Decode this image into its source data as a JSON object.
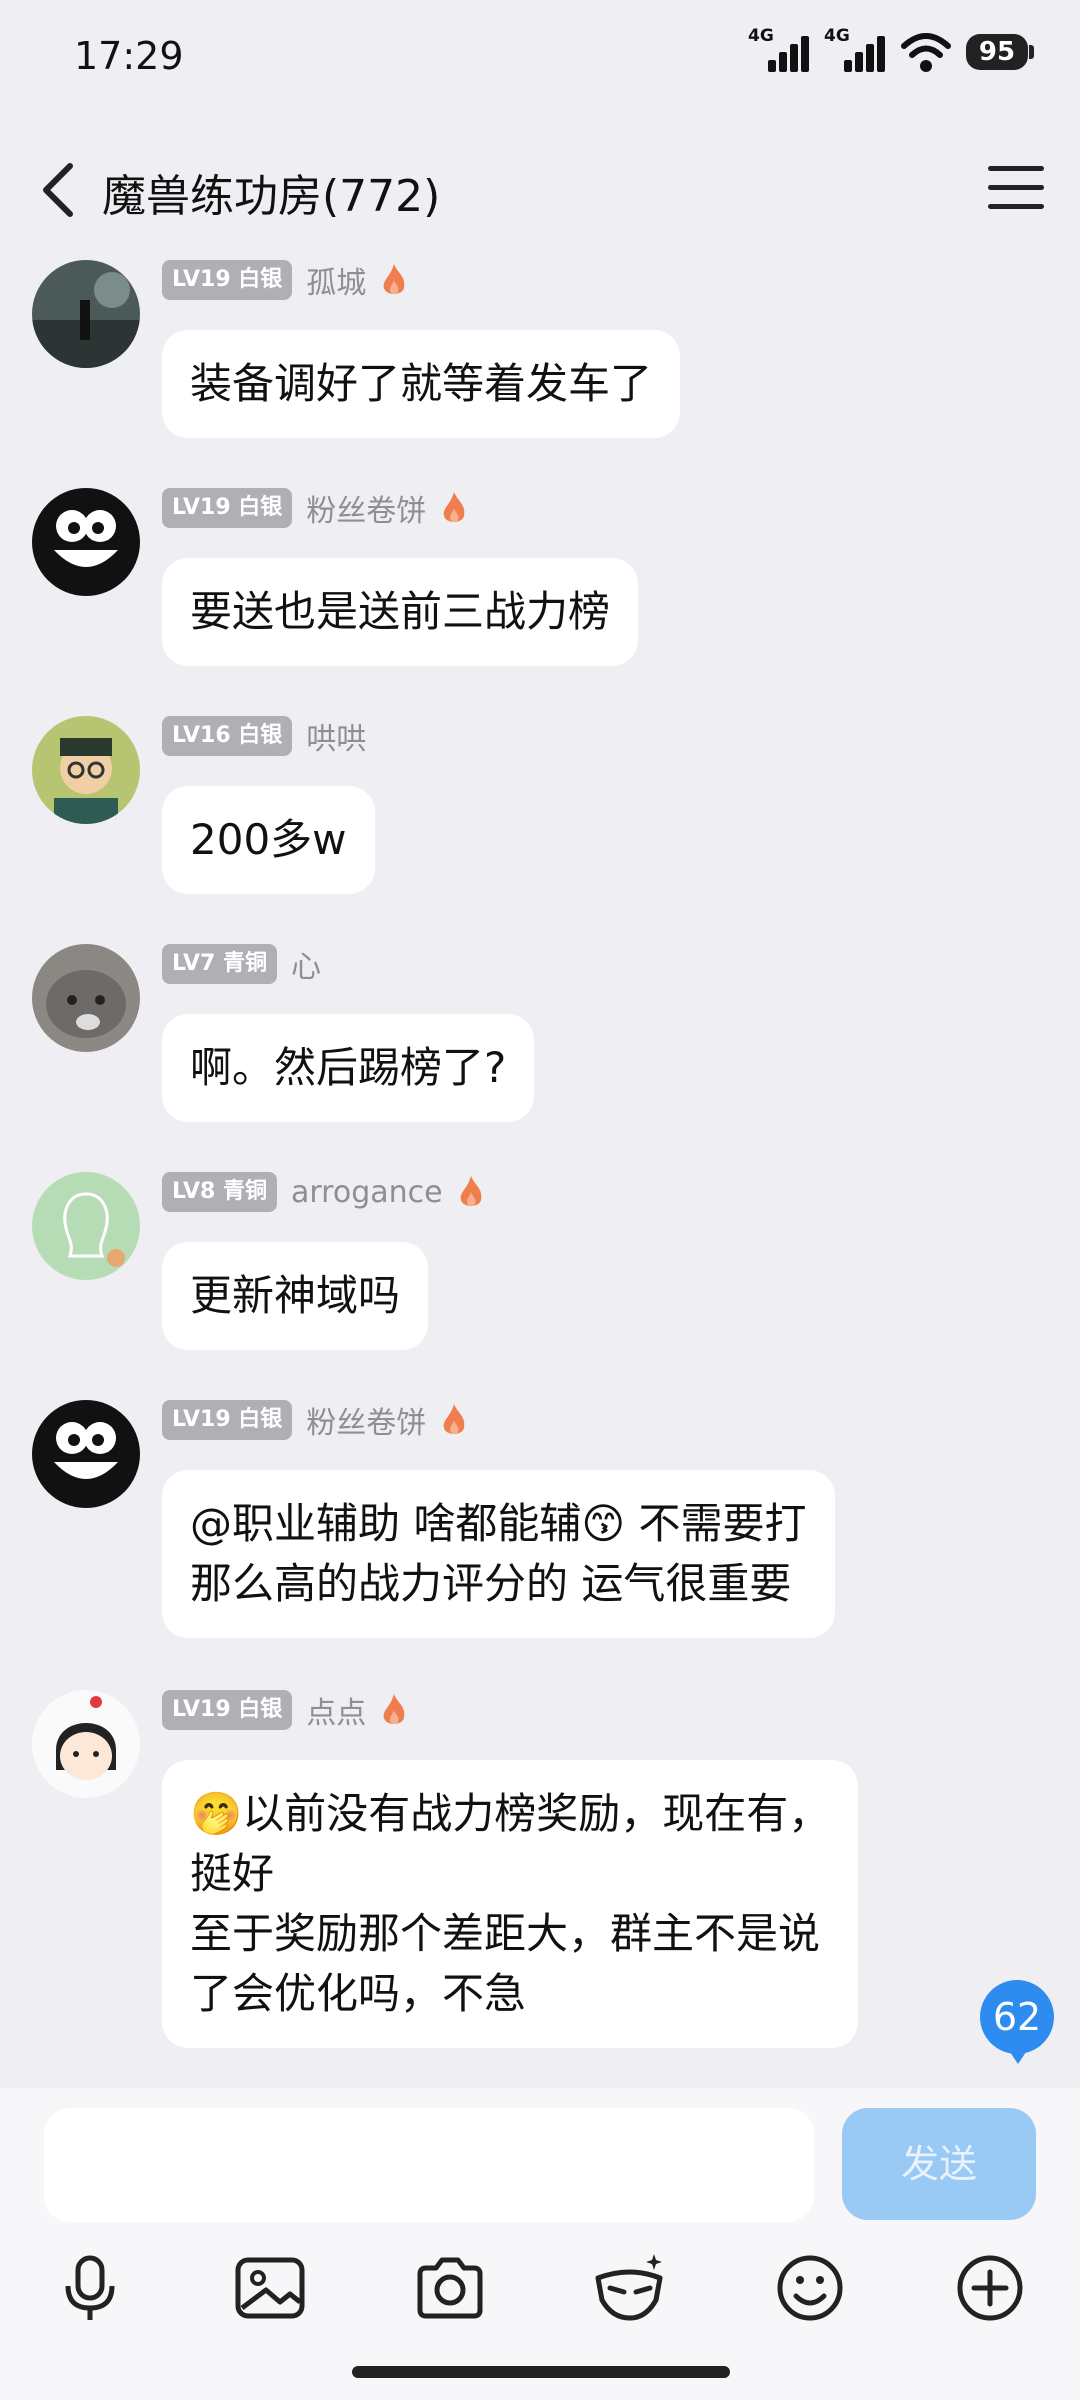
{
  "status_bar": {
    "time": "17:29",
    "network1": "4G",
    "network2": "4G",
    "battery": "95"
  },
  "header": {
    "title": "魔兽练功房(772)"
  },
  "messages": [
    {
      "level": "LV19 白银",
      "name": "孤城",
      "text": "装备调好了就等着发车了"
    },
    {
      "level": "LV19 白银",
      "name": "粉丝卷饼",
      "text": "要送也是送前三战力榜"
    },
    {
      "level": "LV16 白银",
      "name": "哄哄",
      "text": "200多w"
    },
    {
      "level": "LV7 青铜",
      "name": "心",
      "text": "啊。然后踢榜了?"
    },
    {
      "level": "LV8 青铜",
      "name": "arrogance",
      "text": "更新神域吗"
    },
    {
      "level": "LV19 白银",
      "name": "粉丝卷饼",
      "text": "@职业辅助 啥都能辅😙 不需要打\n那么高的战力评分的  运气很重要"
    },
    {
      "level": "LV19 白银",
      "name": "点点",
      "text": "🤭以前没有战力榜奖励，现在有，\n挺好\n至于奖励那个差距大，群主不是说\n了会优化吗，不急"
    }
  ],
  "unread_count": "62",
  "input": {
    "placeholder": "",
    "send_label": "发送"
  },
  "toolbar": [
    "microphone-icon",
    "image-icon",
    "camera-icon",
    "emoji-mask-icon",
    "smiley-icon",
    "plus-icon"
  ],
  "colors": {
    "background": "#efeff3",
    "accent": "#2e8cf0",
    "send_disabled": "#99c9f5",
    "level_badge": "#aeb0b6",
    "flame": "#ef7d4d"
  }
}
